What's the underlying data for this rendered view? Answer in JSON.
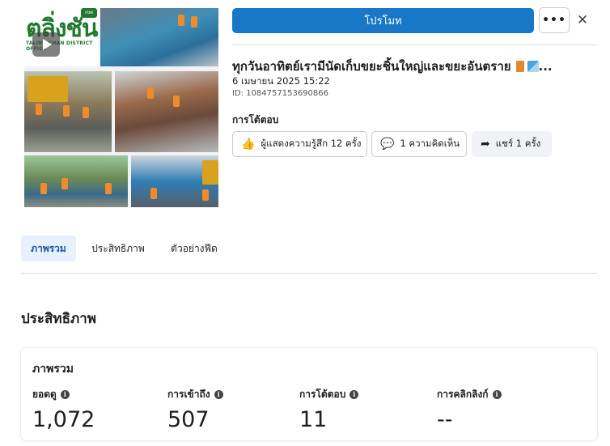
{
  "thumbnail": {
    "logo_text": "ตลิ่งชัน",
    "logo_subtext": "TALING CHAN DISTRICT OFFICE",
    "logo_badge": "เขต"
  },
  "header": {
    "promote_label": "โปรโมท",
    "more_label": "•••",
    "close_label": "✕"
  },
  "post": {
    "title": "ทุกวันอาทิตย์เรามีนัดเก็บขยะชิ้นใหญ่และขยะอันตราย",
    "title_ellipsis": "...",
    "date": "6 เมษายน 2025 15:22",
    "id": "ID: 1084757153690866"
  },
  "reactions": {
    "heading": "การโต้ตอบ",
    "likes_label": "ผู้แสดงความรู้สึก 12 ครั้ง",
    "comments_label": "1 ความคิดเห็น",
    "shares_label": "แชร์ 1 ครั้ง"
  },
  "tabs": [
    {
      "label": "ภาพรวม",
      "active": true
    },
    {
      "label": "ประสิทธิภาพ",
      "active": false
    },
    {
      "label": "ตัวอย่างฟีด",
      "active": false
    }
  ],
  "performance": {
    "heading": "ประสิทธิภาพ",
    "card_title": "ภาพรวม",
    "stats": [
      {
        "label": "ยอดดู",
        "value": "1,072"
      },
      {
        "label": "การเข้าถึง",
        "value": "507"
      },
      {
        "label": "การโต้ตอบ",
        "value": "11"
      },
      {
        "label": "การคลิกลิงก์",
        "value": "--"
      }
    ]
  },
  "colors": {
    "primary": "#1877c9",
    "active_tab_bg": "#e7f0fb",
    "brand_green": "#1e7a2e"
  }
}
